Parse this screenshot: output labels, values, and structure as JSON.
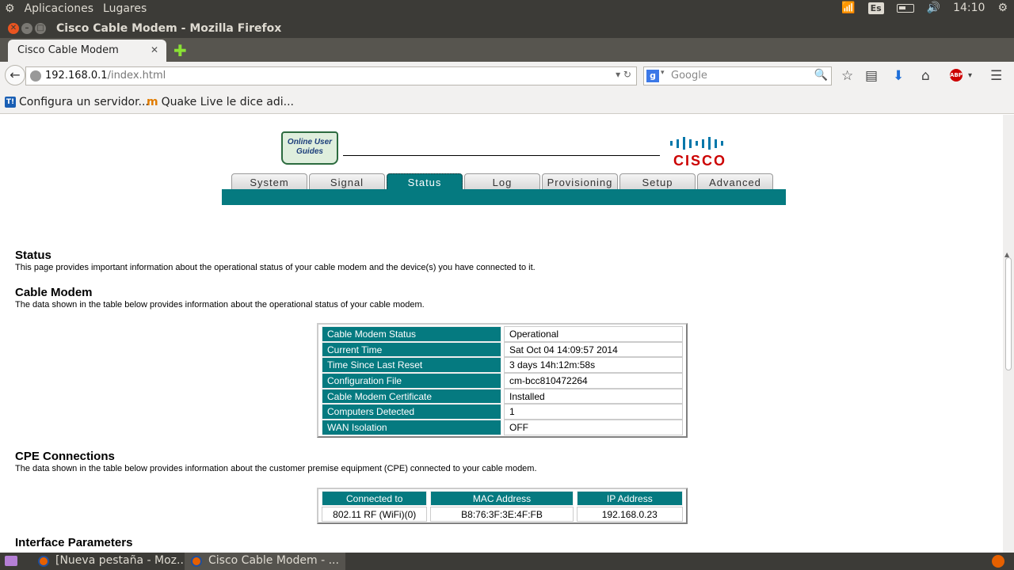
{
  "top_panel": {
    "menu_apps": "Aplicaciones",
    "menu_places": "Lugares",
    "keyboard_layout": "Es",
    "clock": "14:10"
  },
  "window": {
    "title": "Cisco Cable Modem - Mozilla Firefox"
  },
  "browser": {
    "tab_label": "Cisco Cable Modem",
    "url_host": "192.168.0.1",
    "url_path": "/index.html",
    "search_placeholder": "Google",
    "bookmarks": [
      {
        "label": "Configura un servidor..."
      },
      {
        "label": "Quake Live le dice adi..."
      }
    ]
  },
  "page": {
    "online_guides": "Online User Guides",
    "logo_text": "CISCO",
    "tabs": [
      {
        "label": "System"
      },
      {
        "label": "Signal"
      },
      {
        "label": "Status"
      },
      {
        "label": "Log"
      },
      {
        "label": "Provisioning"
      },
      {
        "label": "Setup"
      },
      {
        "label": "Advanced"
      }
    ],
    "status_heading": "Status",
    "status_desc": "This page provides important information about the operational status of your cable modem and the device(s) you have connected to it.",
    "cable_modem_heading": "Cable Modem",
    "cable_modem_desc": "The data shown in the table below provides information about the operational status of your cable modem.",
    "cable_modem_table": [
      {
        "label": "Cable Modem Status",
        "value": "Operational"
      },
      {
        "label": "Current Time",
        "value": "Sat Oct 04 14:09:57 2014"
      },
      {
        "label": "Time Since Last Reset",
        "value": "3 days 14h:12m:58s"
      },
      {
        "label": "Configuration File",
        "value": "cm-bcc810472264"
      },
      {
        "label": "Cable Modem Certificate",
        "value": "Installed"
      },
      {
        "label": "Computers Detected",
        "value": "1"
      },
      {
        "label": "WAN Isolation",
        "value": "OFF"
      }
    ],
    "cpe_heading": "CPE Connections",
    "cpe_desc": "The data shown in the table below provides information about the customer premise equipment (CPE) connected to your cable modem.",
    "cpe_table": {
      "headers": [
        "Connected to",
        "MAC Address",
        "IP Address"
      ],
      "rows": [
        [
          "802.11 RF (WiFi)(0)",
          "B8:76:3F:3E:4F:FB",
          "192.168.0.23"
        ]
      ]
    },
    "interface_heading": "Interface Parameters"
  },
  "taskbar": {
    "items": [
      {
        "label": "[Nueva pestaña - Moz..."
      },
      {
        "label": "Cisco Cable Modem - ..."
      }
    ]
  },
  "colors": {
    "accent_teal": "#057a80",
    "ubuntu_panel": "#3c3b37",
    "cisco_red": "#cc0000"
  }
}
